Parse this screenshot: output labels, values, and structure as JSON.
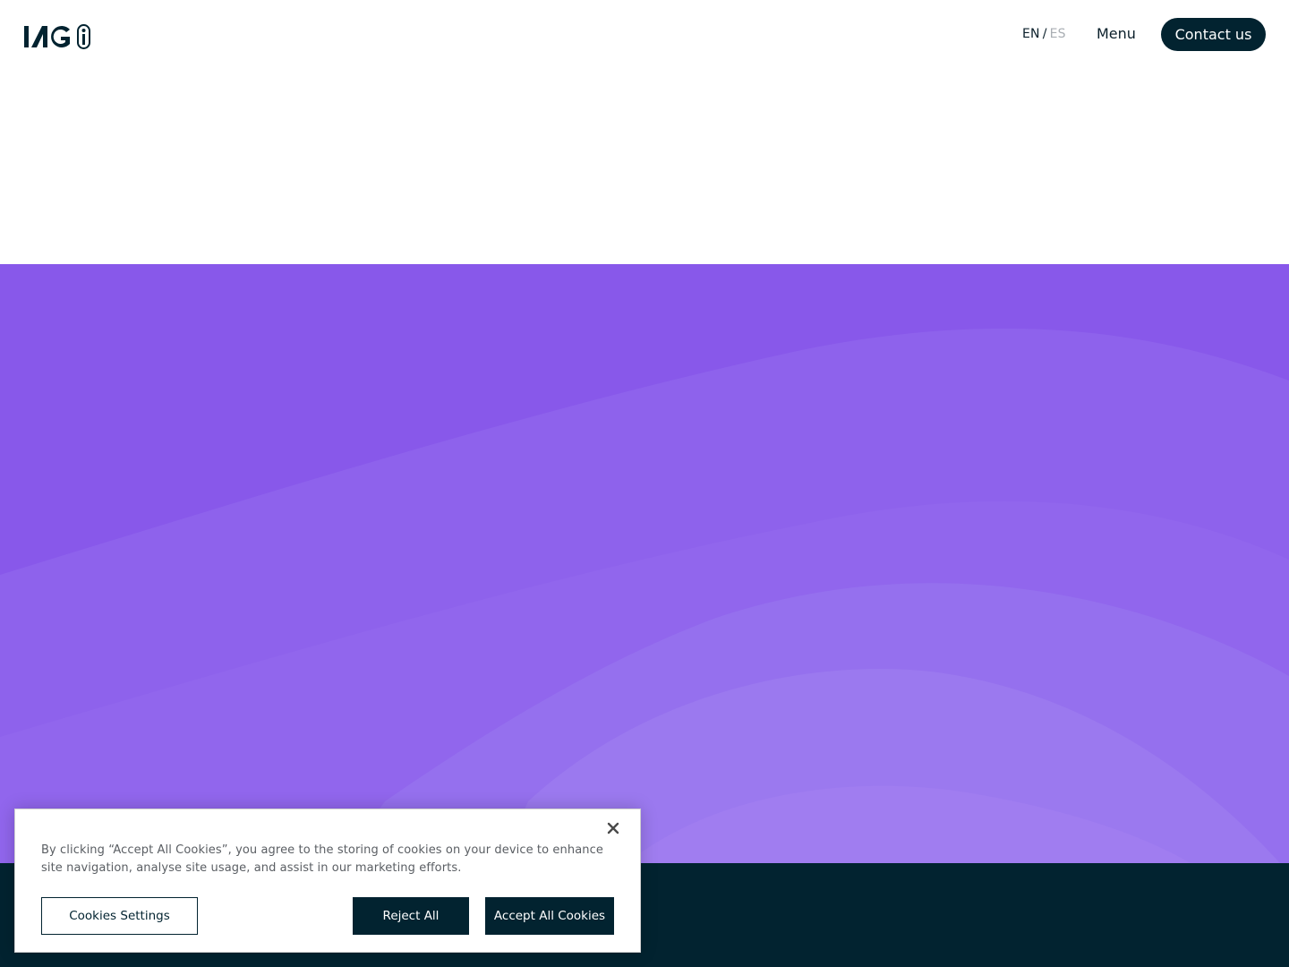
{
  "header": {
    "logo_text": "IAG",
    "lang_en": "EN",
    "lang_separator": "/",
    "lang_es": "ES",
    "menu_label": "Menu",
    "contact_label": "Contact us"
  },
  "colors": {
    "brand_dark": "#022330",
    "hero_purple": "#8858ea",
    "wave_light": "#a07df0",
    "inactive_lang": "#a9aeb3"
  },
  "cookie_banner": {
    "close_icon": "close-icon",
    "text": "By clicking “Accept All Cookies”, you agree to the storing of cookies on your device to enhance site navigation, analyse site usage, and assist in our marketing efforts.",
    "settings_label": "Cookies Settings",
    "reject_label": "Reject All",
    "accept_label": "Accept All Cookies"
  }
}
